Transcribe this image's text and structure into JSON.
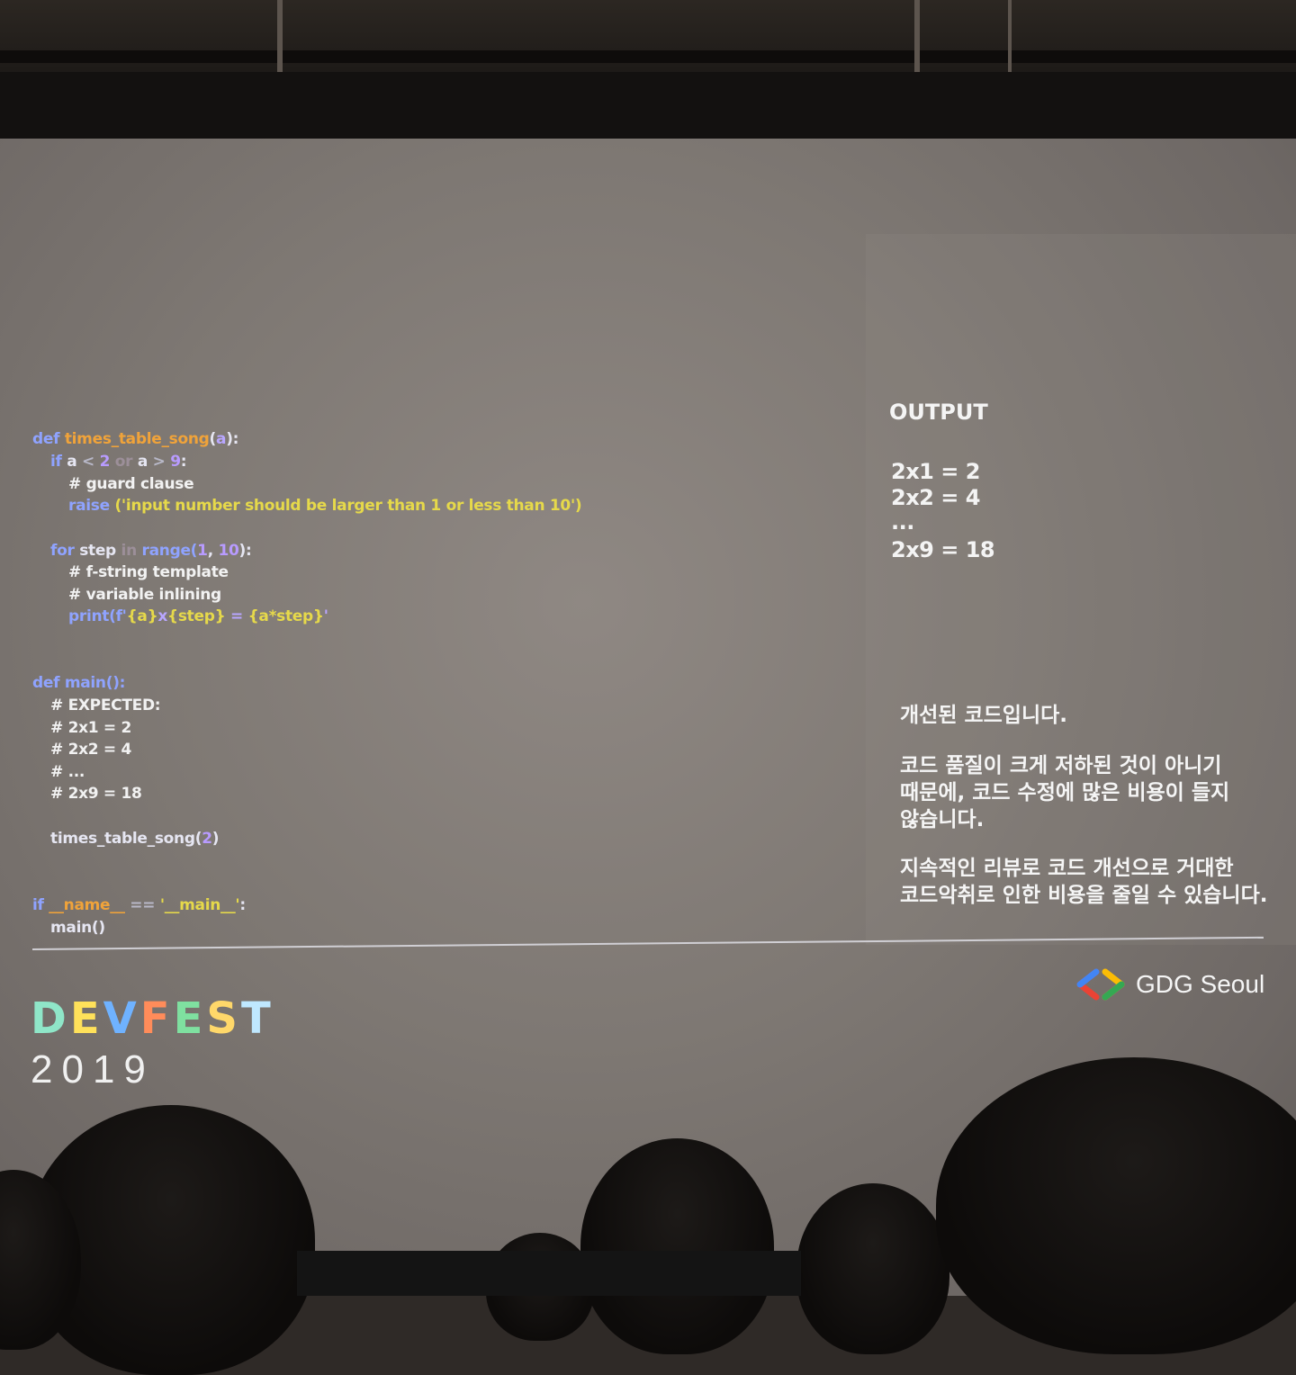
{
  "code": {
    "l1": {
      "def": "def ",
      "fn": "times_table_song",
      "p1": "(",
      "arg": "a",
      "p2": "):"
    },
    "l2": {
      "if": "if ",
      "a1": "a",
      "lt": " < ",
      "n2": "2",
      "or": " or ",
      "a2": "a",
      "gt": " > ",
      "n9": "9",
      "colon": ":"
    },
    "l3": "# guard clause",
    "l4": {
      "raise": "raise ",
      "str": "('input number should be larger than 1 or less than 10')"
    },
    "l5": {
      "for": "for ",
      "step": "step",
      "in": " in ",
      "range": "range(",
      "n1": "1",
      "comma": ", ",
      "n10": "10",
      "end": "):"
    },
    "l6": "# f-string template",
    "l7": "# variable inlining",
    "l8": {
      "print": "print(f'",
      "a": "{a}",
      "x": "x",
      "step": "{step}",
      "eq": " = ",
      "prod": "{a*step}",
      "end": "'"
    },
    "l9": "def main():",
    "l10": "# EXPECTED:",
    "l11": "# 2x1 = 2",
    "l12": "# 2x2 = 4",
    "l13": "# ...",
    "l14": "# 2x9 = 18",
    "l15": {
      "fn": "times_table_song(",
      "n": "2",
      "end": ")"
    },
    "l16": {
      "if": "if ",
      "name": "__name__",
      "eq": " == ",
      "main": "'__main__'",
      "colon": ":"
    },
    "l17": "main()"
  },
  "output": {
    "title": "OUTPUT",
    "lines": [
      "2x1 = 2",
      "2x2 = 4",
      "...",
      "2x9 = 18"
    ]
  },
  "korean": {
    "p1": "개선된 코드입니다.",
    "p2": "코드 품질이 크게 저하된 것이 아니기\n때문에, 코드 수정에 많은 비용이 들지\n않습니다.",
    "p3": "지속적인 리뷰로 코드 개선으로 거대한\n코드악취로 인한 비용을 줄일 수 있습니다."
  },
  "brand": {
    "name": "GDG Seoul"
  },
  "devfest": {
    "letters": [
      "D",
      "E",
      "V",
      "F",
      "E",
      "S",
      "T"
    ],
    "colors": [
      "#8fe6c8",
      "#ffe15a",
      "#6fb2ff",
      "#ff8c5a",
      "#7fe0a0",
      "#ffd86a",
      "#bfe8ff"
    ],
    "year": "2019"
  }
}
